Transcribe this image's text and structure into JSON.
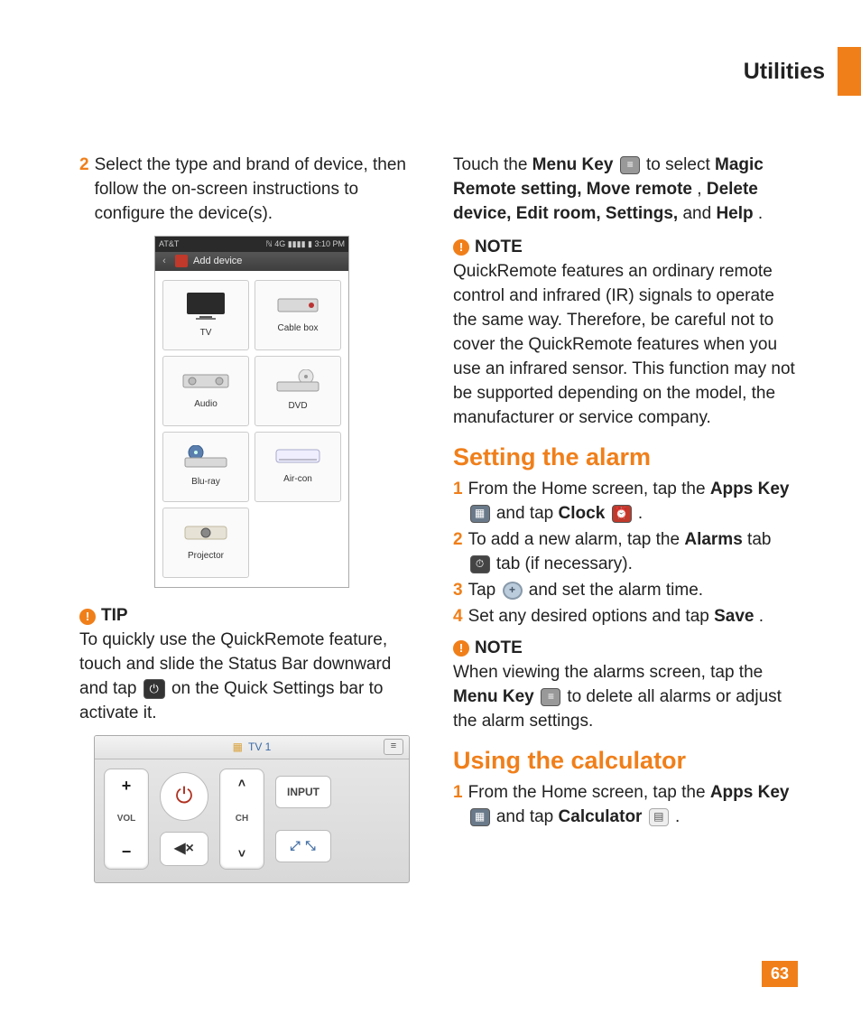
{
  "header": {
    "title": "Utilities"
  },
  "page_number": "63",
  "left": {
    "step2_num": "2",
    "step2_text": "Select the type and brand of device, then follow the on-screen instructions to configure the device(s).",
    "phone": {
      "carrier": "AT&T",
      "status_right": "ℕ 4G ▮▮▮▮ ▮ 3:10 PM",
      "title": "Add device",
      "devices": [
        "TV",
        "Cable box",
        "Audio",
        "DVD",
        "Blu-ray",
        "Air-con",
        "Projector"
      ]
    },
    "tip_label": "TIP",
    "tip_before": "To quickly use the QuickRemote feature, touch and slide the Status Bar downward and tap ",
    "tip_after": " on the Quick Settings bar to activate it.",
    "remote": {
      "title": "TV 1",
      "vol": "VOL",
      "ch": "CH",
      "input": "INPUT"
    }
  },
  "right": {
    "menu_para1": "Touch the ",
    "menu_bold1": "Menu Key",
    "menu_para2": " to select ",
    "menu_bold2": "Magic Remote setting, Move remote",
    "menu_para3": ", ",
    "menu_bold3": "Delete device, Edit room, Settings,",
    "menu_para4": " and ",
    "menu_bold4": "Help",
    "menu_para5": ".",
    "note1_label": "NOTE",
    "note1_text": "QuickRemote features an ordinary remote control and infrared (IR) signals to operate the same way. Therefore, be careful not to cover the QuickRemote features when you use an infrared sensor. This function may not be supported depending on the model, the manufacturer or service company.",
    "heading_alarm": "Setting the alarm",
    "alarm_steps": {
      "s1_num": "1",
      "s1_a": "From the Home screen, tap the ",
      "s1_b": "Apps Key",
      "s1_c": " and tap ",
      "s1_d": "Clock",
      "s1_e": ".",
      "s2_num": "2",
      "s2_a": "To add a new alarm, tap the ",
      "s2_b": "Alarms",
      "s2_c": " tab ",
      "s2_d": " tab (if necessary).",
      "s3_num": "3",
      "s3_a": "Tap ",
      "s3_b": " and set the alarm time.",
      "s4_num": "4",
      "s4_a": "Set any desired options and tap ",
      "s4_b": "Save",
      "s4_c": "."
    },
    "note2_label": "NOTE",
    "note2_a": "When viewing the alarms screen, tap the ",
    "note2_b": "Menu Key",
    "note2_c": " to delete all alarms or adjust the alarm settings.",
    "heading_calc": "Using the calculator",
    "calc_step": {
      "num": "1",
      "a": "From the Home screen, tap the ",
      "b": "Apps Key",
      "c": " and tap ",
      "d": "Calculator",
      "e": "."
    }
  }
}
